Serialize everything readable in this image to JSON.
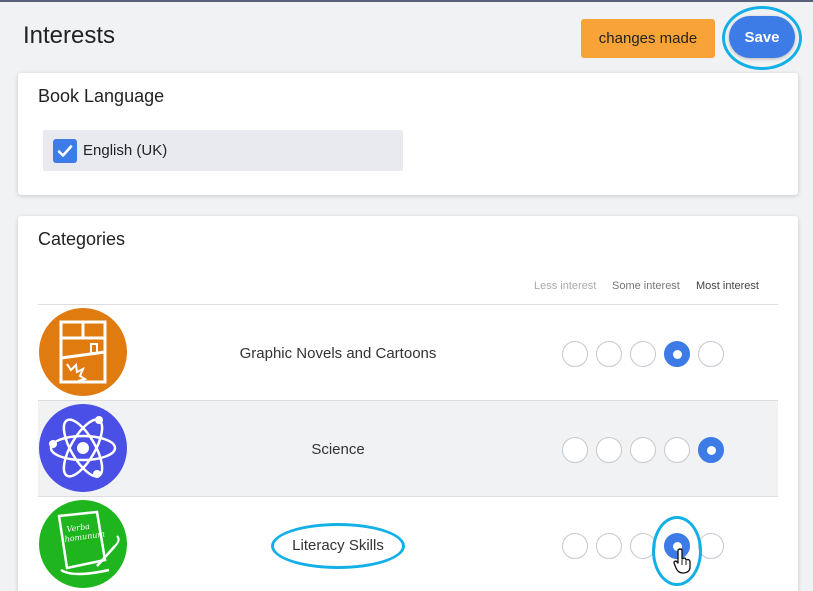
{
  "header": {
    "title": "Interests",
    "changes_label": "changes made",
    "save_label": "Save"
  },
  "book_language": {
    "title": "Book Language",
    "items": [
      {
        "label": "English (UK)",
        "checked": true
      }
    ]
  },
  "categories": {
    "title": "Categories",
    "scale_labels": [
      "Less interest",
      "Some interest",
      "Most interest"
    ],
    "items": [
      {
        "name": "Graphic Novels and Cartoons",
        "icon": "graphic-novels-icon",
        "icon_color": "#e07b10",
        "selected_level": 4,
        "levels": 5
      },
      {
        "name": "Science",
        "icon": "atom-icon",
        "icon_color": "#4a4fe6",
        "selected_level": 5,
        "levels": 5
      },
      {
        "name": "Literacy Skills",
        "icon": "scroll-quill-icon",
        "icon_color": "#1fb51f",
        "icon_text": "Verba homunum",
        "selected_level": 4,
        "levels": 5
      }
    ]
  },
  "colors": {
    "accent": "#3d7be6",
    "changes_badge": "#f7a337",
    "highlight_ring": "#12b0e6"
  }
}
